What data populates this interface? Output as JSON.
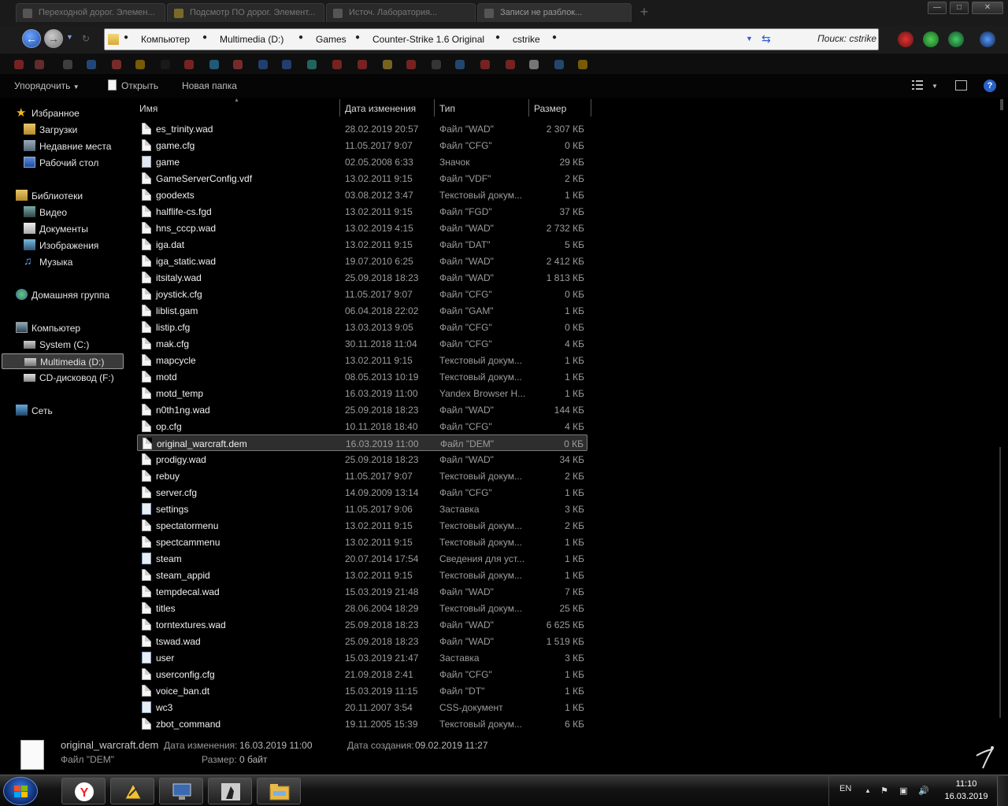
{
  "titlebar": {
    "tabs": [
      {
        "label": "Переходной дорог. Элемен..."
      },
      {
        "label": "Подсмотр ПО дорог. Элемент..."
      },
      {
        "label": "Источ. Лаборатория..."
      },
      {
        "label": "Записи не разблок..."
      }
    ],
    "new_tab": "+",
    "minimize": "—",
    "maximize": "□",
    "close": "✕"
  },
  "address": {
    "crumbs": [
      "Компьютер",
      "Multimedia (D:)",
      "Games",
      "Counter-Strike 1.6 Original",
      "cstrike"
    ],
    "search_placeholder": "Поиск: cstrike"
  },
  "commandbar": {
    "organize": "Упорядочить",
    "open": "Открыть",
    "new_folder": "Новая папка"
  },
  "navpane": {
    "items": [
      {
        "label": "Избранное",
        "icon": "star-icon"
      },
      {
        "label": "Загрузки",
        "icon": "downloads-icon"
      },
      {
        "label": "Недавние места",
        "icon": "recent-places-icon"
      },
      {
        "label": "Рабочий стол",
        "icon": "desktop-icon"
      },
      {
        "label": "Библиотеки",
        "icon": "libraries-icon"
      },
      {
        "label": "Видео",
        "icon": "video-icon"
      },
      {
        "label": "Документы",
        "icon": "documents-icon"
      },
      {
        "label": "Изображения",
        "icon": "pictures-icon"
      },
      {
        "label": "Музыка",
        "icon": "music-icon"
      },
      {
        "label": "Домашняя группа",
        "icon": "homegroup-icon"
      },
      {
        "label": "Компьютер",
        "icon": "computer-icon"
      },
      {
        "label": "System (C:)",
        "icon": "drive-icon"
      },
      {
        "label": "Multimedia (D:)",
        "icon": "drive-icon"
      },
      {
        "label": "CD-дисковод (F:)",
        "icon": "cd-drive-icon"
      },
      {
        "label": "Сеть",
        "icon": "network-icon"
      }
    ]
  },
  "columns": {
    "name": "Имя",
    "date": "Дата изменения",
    "type": "Тип",
    "size": "Размер"
  },
  "files": [
    {
      "name": "es_trinity.wad",
      "date": "28.02.2019 20:57",
      "type": "Файл \"WAD\"",
      "size": "2 307 КБ",
      "icon": "file-icon"
    },
    {
      "name": "game.cfg",
      "date": "11.05.2017 9:07",
      "type": "Файл \"CFG\"",
      "size": "0 КБ",
      "icon": "file-icon"
    },
    {
      "name": "game",
      "date": "02.05.2008 6:33",
      "type": "Значок",
      "size": "29 КБ",
      "icon": "cs-icon"
    },
    {
      "name": "GameServerConfig.vdf",
      "date": "13.02.2011 9:15",
      "type": "Файл \"VDF\"",
      "size": "2 КБ",
      "icon": "file-icon"
    },
    {
      "name": "goodexts",
      "date": "03.08.2012 3:47",
      "type": "Текстовый докум...",
      "size": "1 КБ",
      "icon": "text-file-icon"
    },
    {
      "name": "halflife-cs.fgd",
      "date": "13.02.2011 9:15",
      "type": "Файл \"FGD\"",
      "size": "37 КБ",
      "icon": "file-icon"
    },
    {
      "name": "hns_cccp.wad",
      "date": "13.02.2019 4:15",
      "type": "Файл \"WAD\"",
      "size": "2 732 КБ",
      "icon": "file-icon"
    },
    {
      "name": "iga.dat",
      "date": "13.02.2011 9:15",
      "type": "Файл \"DAT\"",
      "size": "5 КБ",
      "icon": "file-icon"
    },
    {
      "name": "iga_static.wad",
      "date": "19.07.2010 6:25",
      "type": "Файл \"WAD\"",
      "size": "2 412 КБ",
      "icon": "file-icon"
    },
    {
      "name": "itsitaly.wad",
      "date": "25.09.2018 18:23",
      "type": "Файл \"WAD\"",
      "size": "1 813 КБ",
      "icon": "file-icon"
    },
    {
      "name": "joystick.cfg",
      "date": "11.05.2017 9:07",
      "type": "Файл \"CFG\"",
      "size": "0 КБ",
      "icon": "file-icon"
    },
    {
      "name": "liblist.gam",
      "date": "06.04.2018 22:02",
      "type": "Файл \"GAM\"",
      "size": "1 КБ",
      "icon": "file-icon"
    },
    {
      "name": "listip.cfg",
      "date": "13.03.2013 9:05",
      "type": "Файл \"CFG\"",
      "size": "0 КБ",
      "icon": "file-icon"
    },
    {
      "name": "mak.cfg",
      "date": "30.11.2018 11:04",
      "type": "Файл \"CFG\"",
      "size": "4 КБ",
      "icon": "file-icon"
    },
    {
      "name": "mapcycle",
      "date": "13.02.2011 9:15",
      "type": "Текстовый докум...",
      "size": "1 КБ",
      "icon": "text-file-icon"
    },
    {
      "name": "motd",
      "date": "08.05.2013 10:19",
      "type": "Текстовый докум...",
      "size": "1 КБ",
      "icon": "text-file-icon"
    },
    {
      "name": "motd_temp",
      "date": "16.03.2019 11:00",
      "type": "Yandex Browser H...",
      "size": "1 КБ",
      "icon": "html-file-icon"
    },
    {
      "name": "n0th1ng.wad",
      "date": "25.09.2018 18:23",
      "type": "Файл \"WAD\"",
      "size": "144 КБ",
      "icon": "file-icon"
    },
    {
      "name": "op.cfg",
      "date": "10.11.2018 18:40",
      "type": "Файл \"CFG\"",
      "size": "4 КБ",
      "icon": "file-icon"
    },
    {
      "name": "original_warcraft.dem",
      "date": "16.03.2019 11:00",
      "type": "Файл \"DEM\"",
      "size": "0 КБ",
      "icon": "file-icon",
      "selected": true
    },
    {
      "name": "prodigy.wad",
      "date": "25.09.2018 18:23",
      "type": "Файл \"WAD\"",
      "size": "34 КБ",
      "icon": "file-icon"
    },
    {
      "name": "rebuy",
      "date": "11.05.2017 9:07",
      "type": "Текстовый докум...",
      "size": "2 КБ",
      "icon": "text-file-icon"
    },
    {
      "name": "server.cfg",
      "date": "14.09.2009 13:14",
      "type": "Файл \"CFG\"",
      "size": "1 КБ",
      "icon": "file-icon"
    },
    {
      "name": "settings",
      "date": "11.05.2017 9:06",
      "type": "Заставка",
      "size": "3 КБ",
      "icon": "screensaver-icon"
    },
    {
      "name": "spectatormenu",
      "date": "13.02.2011 9:15",
      "type": "Текстовый докум...",
      "size": "2 КБ",
      "icon": "text-file-icon"
    },
    {
      "name": "spectcammenu",
      "date": "13.02.2011 9:15",
      "type": "Текстовый докум...",
      "size": "1 КБ",
      "icon": "text-file-icon"
    },
    {
      "name": "steam",
      "date": "20.07.2014 17:54",
      "type": "Сведения для уст...",
      "size": "1 КБ",
      "icon": "setup-info-icon"
    },
    {
      "name": "steam_appid",
      "date": "13.02.2011 9:15",
      "type": "Текстовый докум...",
      "size": "1 КБ",
      "icon": "text-file-icon"
    },
    {
      "name": "tempdecal.wad",
      "date": "15.03.2019 21:48",
      "type": "Файл \"WAD\"",
      "size": "7 КБ",
      "icon": "file-icon"
    },
    {
      "name": "titles",
      "date": "28.06.2004 18:29",
      "type": "Текстовый докум...",
      "size": "25 КБ",
      "icon": "text-file-icon"
    },
    {
      "name": "torntextures.wad",
      "date": "25.09.2018 18:23",
      "type": "Файл \"WAD\"",
      "size": "6 625 КБ",
      "icon": "file-icon"
    },
    {
      "name": "tswad.wad",
      "date": "25.09.2018 18:23",
      "type": "Файл \"WAD\"",
      "size": "1 519 КБ",
      "icon": "file-icon"
    },
    {
      "name": "user",
      "date": "15.03.2019 21:47",
      "type": "Заставка",
      "size": "3 КБ",
      "icon": "screensaver-icon"
    },
    {
      "name": "userconfig.cfg",
      "date": "21.09.2018 2:41",
      "type": "Файл \"CFG\"",
      "size": "1 КБ",
      "icon": "file-icon"
    },
    {
      "name": "voice_ban.dt",
      "date": "15.03.2019 11:15",
      "type": "Файл \"DT\"",
      "size": "1 КБ",
      "icon": "file-icon"
    },
    {
      "name": "wc3",
      "date": "20.11.2007 3:54",
      "type": "CSS-документ",
      "size": "1 КБ",
      "icon": "css-file-icon"
    },
    {
      "name": "zbot_command",
      "date": "19.11.2005 15:39",
      "type": "Текстовый докум...",
      "size": "6 КБ",
      "icon": "text-file-icon"
    }
  ],
  "details": {
    "name": "original_warcraft.dem",
    "type": "Файл \"DEM\"",
    "modified_label": "Дата изменения:",
    "modified_value": "16.03.2019 11:00",
    "size_label": "Размер:",
    "size_value": "0 байт",
    "created_label": "Дата создания:",
    "created_value": "09.02.2019 11:27"
  },
  "taskbar": {
    "apps": [
      "yandex-browser-icon",
      "winamp-icon",
      "monitor-icon",
      "counter-strike-icon",
      "explorer-icon"
    ],
    "lang": "EN",
    "time": "11:10",
    "date": "16.03.2019"
  }
}
